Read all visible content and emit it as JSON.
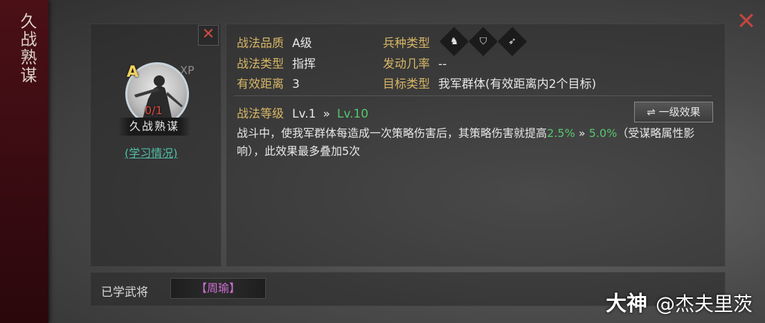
{
  "side_title": "久战熟谋",
  "icons": {
    "close": "close-icon",
    "arrow": "double-chevron-right-icon",
    "swap": "swap-icon"
  },
  "skill": {
    "grade_letter": "A",
    "xp_label": "XP",
    "progress": "0/1",
    "name_plate": "久战熟谋",
    "learn_link": "(学习情况)"
  },
  "info": {
    "quality_label": "战法品质",
    "quality_value": "A级",
    "type_label": "战法类型",
    "type_value": "指挥",
    "range_label": "有效距离",
    "range_value": "3",
    "troop_label": "兵种类型",
    "troop_icons": [
      "cavalry-icon",
      "shield-icon",
      "archer-icon"
    ],
    "rate_label": "发动几率",
    "rate_value": "--",
    "target_label": "目标类型",
    "target_value": "我军群体(有效距离内2个目标)"
  },
  "level": {
    "label": "战法等级",
    "current": "Lv.1",
    "arrow": "»",
    "max": "Lv.10",
    "effect_button": "⇌ 一级效果"
  },
  "description": {
    "part1": "战斗中，使我军群体每造成一次策略伤害后，其策略伤害就提高",
    "val1": "2.5%",
    "arrow": " » ",
    "val2": "5.0%",
    "part2": "（受谋略属性影响），此效果最多叠加5次"
  },
  "learned": {
    "label": "已学武将",
    "general": "【周瑜】"
  },
  "watermark": {
    "brand": "大神",
    "user": "@杰夫里茨"
  }
}
